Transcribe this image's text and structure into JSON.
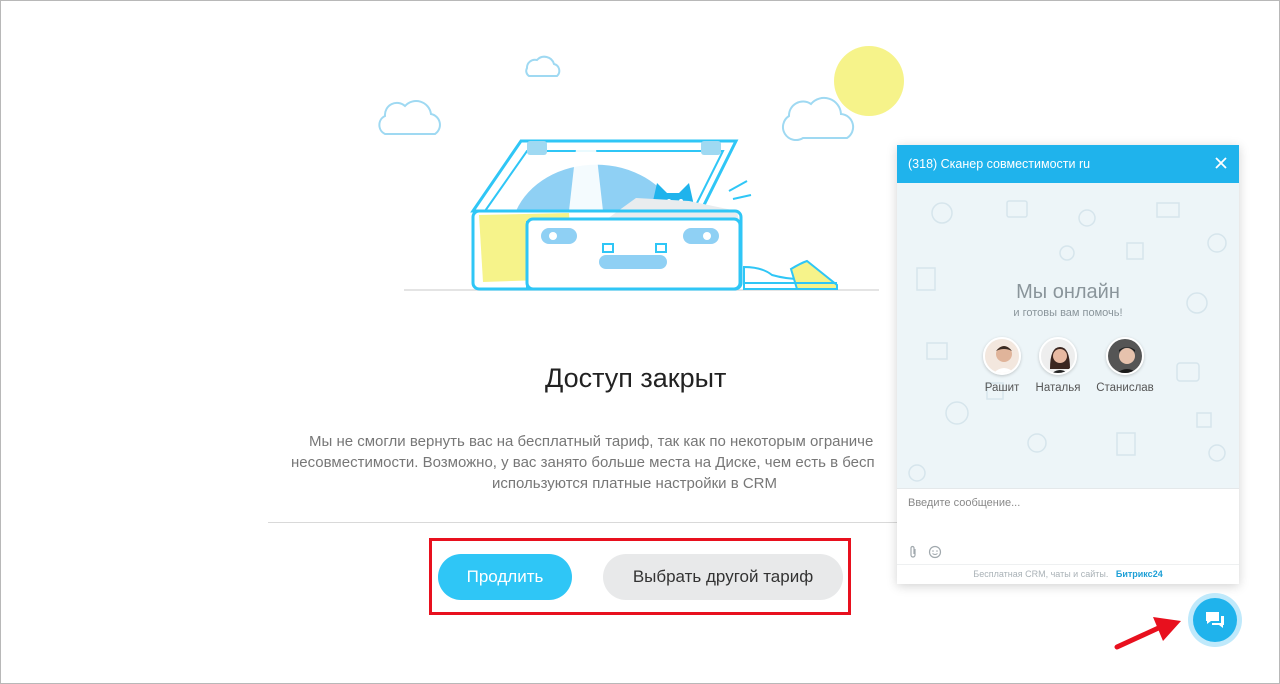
{
  "page": {
    "title": "Доступ закрыт",
    "description_lines": [
      "Мы не смогли вернуть вас на бесплатный тариф, так как по некоторым ограниче",
      "несовместимости. Возможно, у вас занято больше места на Диске, чем есть в бесп",
      "используются платные настройки в CRM"
    ],
    "primary_button": "Продлить",
    "secondary_button": "Выбрать другой тариф"
  },
  "chat": {
    "header_title": "(318) Сканер совместимости ru",
    "online_title": "Мы онлайн",
    "online_subtitle": "и готовы вам помочь!",
    "operators": [
      {
        "name": "Рашит"
      },
      {
        "name": "Наталья"
      },
      {
        "name": "Станислав"
      }
    ],
    "input_placeholder": "Введите сообщение...",
    "footer_text": "Бесплатная CRM, чаты и сайты.",
    "footer_brand": "Битрикс",
    "footer_brand_num": "24"
  },
  "colors": {
    "accent": "#2fc6f6",
    "chat_header": "#1fb3ec",
    "highlight_box": "#e8101e",
    "sun": "#f6f38a"
  },
  "icons": [
    "close-icon",
    "attach-icon",
    "emoji-icon",
    "chat-bubble-icon",
    "pointer-arrow-icon"
  ]
}
